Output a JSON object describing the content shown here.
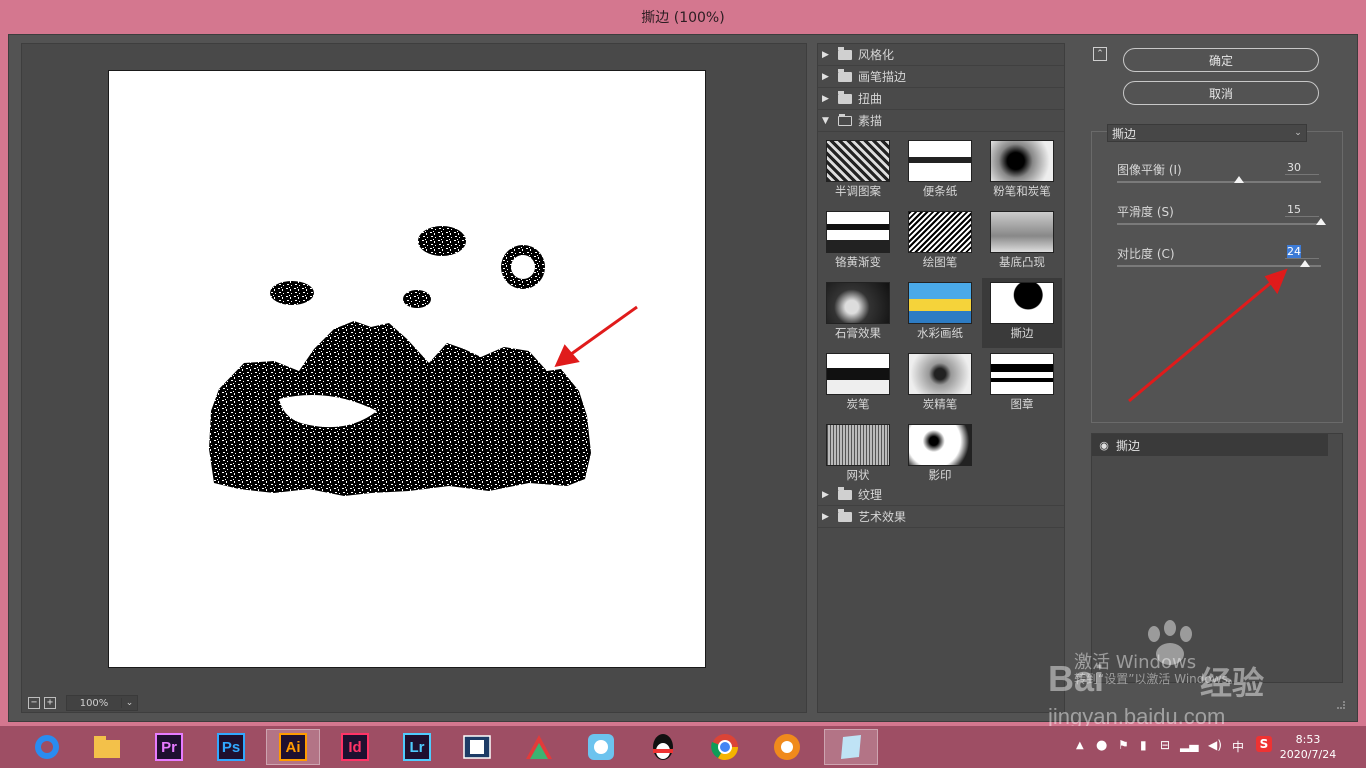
{
  "window": {
    "title": "撕边 (100%)"
  },
  "preview": {
    "zoom": "100%",
    "zoom_out": "−",
    "zoom_in": "+"
  },
  "gallery": {
    "categories_top": [
      {
        "label": "风格化",
        "open": false
      },
      {
        "label": "画笔描边",
        "open": false
      },
      {
        "label": "扭曲",
        "open": false
      },
      {
        "label": "素描",
        "open": true
      }
    ],
    "sketch_filters": [
      {
        "label": "半调图案",
        "selected": false
      },
      {
        "label": "便条纸",
        "selected": false
      },
      {
        "label": "粉笔和炭笔",
        "selected": false
      },
      {
        "label": "铬黄渐变",
        "selected": false
      },
      {
        "label": "绘图笔",
        "selected": false
      },
      {
        "label": "基底凸现",
        "selected": false
      },
      {
        "label": "石膏效果",
        "selected": false
      },
      {
        "label": "水彩画纸",
        "selected": false
      },
      {
        "label": "撕边",
        "selected": true
      },
      {
        "label": "炭笔",
        "selected": false
      },
      {
        "label": "炭精笔",
        "selected": false
      },
      {
        "label": "图章",
        "selected": false
      },
      {
        "label": "网状",
        "selected": false
      },
      {
        "label": "影印",
        "selected": false
      }
    ],
    "categories_bottom": [
      {
        "label": "纹理",
        "open": false
      },
      {
        "label": "艺术效果",
        "open": false
      }
    ]
  },
  "settings": {
    "ok_label": "确定",
    "cancel_label": "取消",
    "filter_name": "撕边",
    "params": [
      {
        "label": "图像平衡 (I)",
        "value": "30",
        "fraction": 0.6
      },
      {
        "label": "平滑度 (S)",
        "value": "15",
        "fraction": 1.0
      },
      {
        "label": "对比度 (C)",
        "value": "24",
        "fraction": 0.92
      }
    ],
    "layer_name": "撕边"
  },
  "watermark": {
    "activate": "激活 Windows",
    "goto": "转到“设置”以激活 Windows。",
    "brand": "Bai",
    "brand2": "经验",
    "url": "jingyan.baidu.com"
  },
  "taskbar": {
    "apps": [
      "Pr",
      "Ps",
      "Ai",
      "Id",
      "Lr"
    ],
    "active_app": "Ai",
    "time": "8:53",
    "date": "2020/7/24",
    "ime": "中",
    "colors": {
      "pr": "#e77bff",
      "ps": "#31a8ff",
      "ai": "#ff9a00",
      "id": "#ff3366",
      "lr": "#4fccfe"
    }
  }
}
